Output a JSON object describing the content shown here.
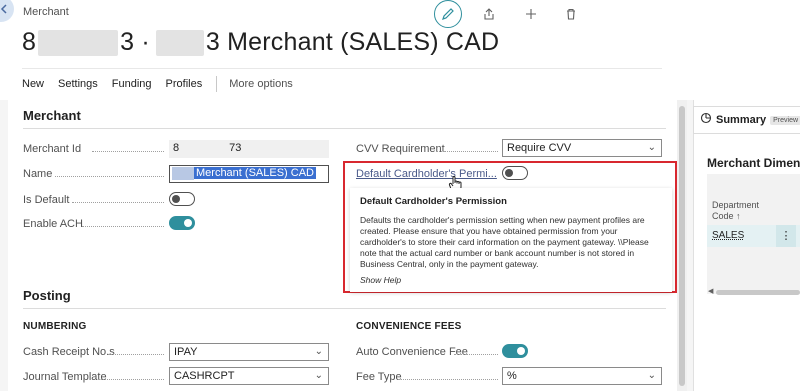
{
  "header": {
    "breadcrumb": "Merchant",
    "title_prefix": "8",
    "title_mid": "3 ·",
    "title_suffix": "3 Merchant (SALES) CAD"
  },
  "actions": {
    "items": [
      "New",
      "Settings",
      "Funding",
      "Profiles"
    ],
    "more": "More options"
  },
  "merchant_section": {
    "title": "Merchant",
    "merchant_id_label": "Merchant Id",
    "merchant_id_value_start": "8",
    "merchant_id_value_end": "73",
    "name_label": "Name",
    "name_value": "Merchant (SALES) CAD",
    "is_default_label": "Is Default",
    "is_default": false,
    "enable_ach_label": "Enable ACH",
    "enable_ach": true,
    "cvv_label": "CVV Requirement",
    "cvv_value": "Require CVV",
    "default_perm_label": "Default Cardholder's Permi...",
    "default_perm": false
  },
  "tooltip": {
    "title": "Default Cardholder's Permission",
    "body": "Defaults the cardholder's permission setting when new payment profiles are created. Please ensure that you have obtained permission from your cardholder's to store their card information on the payment gateway. \\\\Please note that the actual card number or bank account number is not stored in Business Central, only in the payment gateway.",
    "show_help": "Show Help"
  },
  "posting_section": {
    "title": "Posting",
    "numbering_title": "NUMBERING",
    "cash_receipt_label": "Cash Receipt No.s",
    "cash_receipt_value": "IPAY",
    "journal_template_label": "Journal Template",
    "journal_template_value": "CASHRCPT",
    "convenience_title": "CONVENIENCE FEES",
    "auto_fee_label": "Auto Convenience Fee",
    "auto_fee": true,
    "fee_type_label": "Fee Type",
    "fee_type_value": "%"
  },
  "summary": {
    "label": "Summary",
    "badge": "Preview",
    "dimensions_title": "Merchant Dimens",
    "column_header": "Department Code ↑",
    "row_value": "SALES"
  },
  "colors": {
    "accent": "#2f8f9d",
    "highlight_border": "#d8282f",
    "selection": "#3a6fd0"
  }
}
